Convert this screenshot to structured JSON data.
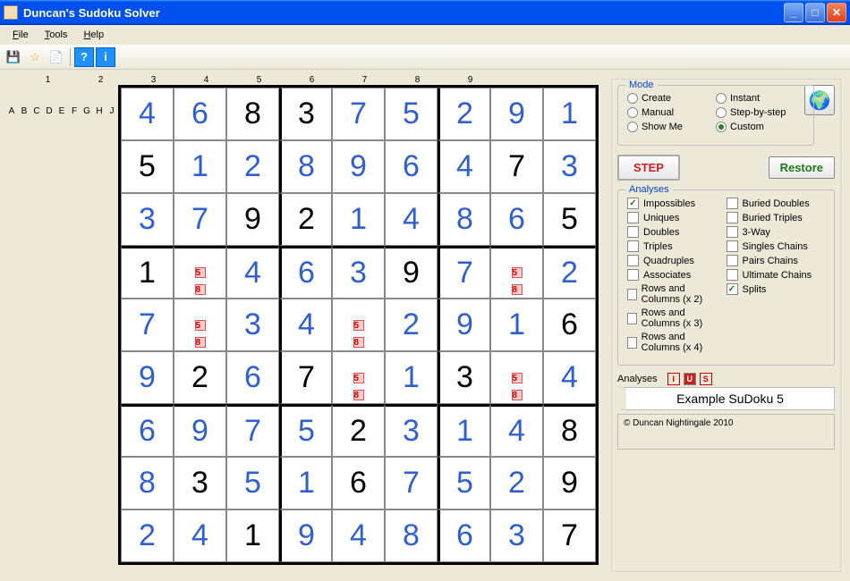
{
  "window": {
    "title": "Duncan's Sudoku Solver"
  },
  "menu": {
    "file": "File",
    "tools": "Tools",
    "help": "Help"
  },
  "toolbar": {
    "save": "💾",
    "star": "☆",
    "new": "📄",
    "help": "?",
    "info": "i"
  },
  "grid": {
    "cols": [
      "1",
      "2",
      "3",
      "4",
      "5",
      "6",
      "7",
      "8",
      "9"
    ],
    "rows": [
      "A",
      "B",
      "C",
      "D",
      "E",
      "F",
      "G",
      "H",
      "J"
    ],
    "cells": [
      [
        {
          "v": "4",
          "t": "s"
        },
        {
          "v": "6",
          "t": "s"
        },
        {
          "v": "8",
          "t": "g"
        },
        {
          "v": "3",
          "t": "g"
        },
        {
          "v": "7",
          "t": "s"
        },
        {
          "v": "5",
          "t": "s"
        },
        {
          "v": "2",
          "t": "s"
        },
        {
          "v": "9",
          "t": "s"
        },
        {
          "v": "1",
          "t": "s"
        }
      ],
      [
        {
          "v": "5",
          "t": "g"
        },
        {
          "v": "1",
          "t": "s"
        },
        {
          "v": "2",
          "t": "s"
        },
        {
          "v": "8",
          "t": "s"
        },
        {
          "v": "9",
          "t": "s"
        },
        {
          "v": "6",
          "t": "s"
        },
        {
          "v": "4",
          "t": "s"
        },
        {
          "v": "7",
          "t": "g"
        },
        {
          "v": "3",
          "t": "s"
        }
      ],
      [
        {
          "v": "3",
          "t": "s"
        },
        {
          "v": "7",
          "t": "s"
        },
        {
          "v": "9",
          "t": "g"
        },
        {
          "v": "2",
          "t": "g"
        },
        {
          "v": "1",
          "t": "s"
        },
        {
          "v": "4",
          "t": "s"
        },
        {
          "v": "8",
          "t": "s"
        },
        {
          "v": "6",
          "t": "s"
        },
        {
          "v": "5",
          "t": "g"
        }
      ],
      [
        {
          "v": "1",
          "t": "g"
        },
        {
          "c": [
            "5",
            "8"
          ]
        },
        {
          "v": "4",
          "t": "s"
        },
        {
          "v": "6",
          "t": "s"
        },
        {
          "v": "3",
          "t": "s"
        },
        {
          "v": "9",
          "t": "g"
        },
        {
          "v": "7",
          "t": "s"
        },
        {
          "c": [
            "5",
            "8"
          ]
        },
        {
          "v": "2",
          "t": "s"
        }
      ],
      [
        {
          "v": "7",
          "t": "s"
        },
        {
          "c": [
            "5",
            "8"
          ]
        },
        {
          "v": "3",
          "t": "s"
        },
        {
          "v": "4",
          "t": "s"
        },
        {
          "c": [
            "5",
            "8"
          ]
        },
        {
          "v": "2",
          "t": "s"
        },
        {
          "v": "9",
          "t": "s"
        },
        {
          "v": "1",
          "t": "s"
        },
        {
          "v": "6",
          "t": "g"
        }
      ],
      [
        {
          "v": "9",
          "t": "s"
        },
        {
          "v": "2",
          "t": "g"
        },
        {
          "v": "6",
          "t": "s"
        },
        {
          "v": "7",
          "t": "g"
        },
        {
          "c": [
            "5",
            "8"
          ]
        },
        {
          "v": "1",
          "t": "s"
        },
        {
          "v": "3",
          "t": "g"
        },
        {
          "c": [
            "5",
            "8"
          ]
        },
        {
          "v": "4",
          "t": "s"
        }
      ],
      [
        {
          "v": "6",
          "t": "s"
        },
        {
          "v": "9",
          "t": "s"
        },
        {
          "v": "7",
          "t": "s"
        },
        {
          "v": "5",
          "t": "s"
        },
        {
          "v": "2",
          "t": "g"
        },
        {
          "v": "3",
          "t": "s"
        },
        {
          "v": "1",
          "t": "s"
        },
        {
          "v": "4",
          "t": "s"
        },
        {
          "v": "8",
          "t": "g"
        }
      ],
      [
        {
          "v": "8",
          "t": "s"
        },
        {
          "v": "3",
          "t": "g"
        },
        {
          "v": "5",
          "t": "s"
        },
        {
          "v": "1",
          "t": "s"
        },
        {
          "v": "6",
          "t": "g"
        },
        {
          "v": "7",
          "t": "s"
        },
        {
          "v": "5",
          "t": "s"
        },
        {
          "v": "2",
          "t": "s"
        },
        {
          "v": "9",
          "t": "g"
        }
      ],
      [
        {
          "v": "2",
          "t": "s"
        },
        {
          "v": "4",
          "t": "s"
        },
        {
          "v": "1",
          "t": "g"
        },
        {
          "v": "9",
          "t": "s"
        },
        {
          "v": "4",
          "t": "s"
        },
        {
          "v": "8",
          "t": "s"
        },
        {
          "v": "6",
          "t": "s"
        },
        {
          "v": "3",
          "t": "s"
        },
        {
          "v": "7",
          "t": "g"
        }
      ]
    ]
  },
  "mode": {
    "title": "Mode",
    "options": [
      {
        "label": "Create",
        "checked": false
      },
      {
        "label": "Instant",
        "checked": false
      },
      {
        "label": "Manual",
        "checked": false
      },
      {
        "label": "Step-by-step",
        "checked": false
      },
      {
        "label": "Show Me",
        "checked": false
      },
      {
        "label": "Custom",
        "checked": true
      }
    ]
  },
  "buttons": {
    "step": "STEP",
    "restore": "Restore"
  },
  "analyses": {
    "title": "Analyses",
    "left": [
      {
        "label": "Impossibles",
        "checked": true
      },
      {
        "label": "Uniques",
        "checked": false
      },
      {
        "label": "Doubles",
        "checked": false
      },
      {
        "label": "Triples",
        "checked": false
      },
      {
        "label": "Quadruples",
        "checked": false
      },
      {
        "label": "Associates",
        "checked": false
      },
      {
        "label": "Rows and Columns (x 2)",
        "checked": false
      },
      {
        "label": "Rows and Columns (x 3)",
        "checked": false
      },
      {
        "label": "Rows and Columns (x 4)",
        "checked": false
      }
    ],
    "right": [
      {
        "label": "Buried Doubles",
        "checked": false
      },
      {
        "label": "Buried Triples",
        "checked": false
      },
      {
        "label": "3-Way",
        "checked": false
      },
      {
        "label": "Singles Chains",
        "checked": false
      },
      {
        "label": "Pairs Chains",
        "checked": false
      },
      {
        "label": "Ultimate Chains",
        "checked": false
      },
      {
        "label": "Splits",
        "checked": true
      }
    ]
  },
  "status": {
    "label": "Analyses",
    "badges": [
      "I",
      "U",
      "S"
    ],
    "example": "Example SuDoku 5",
    "copyright": "© Duncan Nightingale 2010"
  }
}
